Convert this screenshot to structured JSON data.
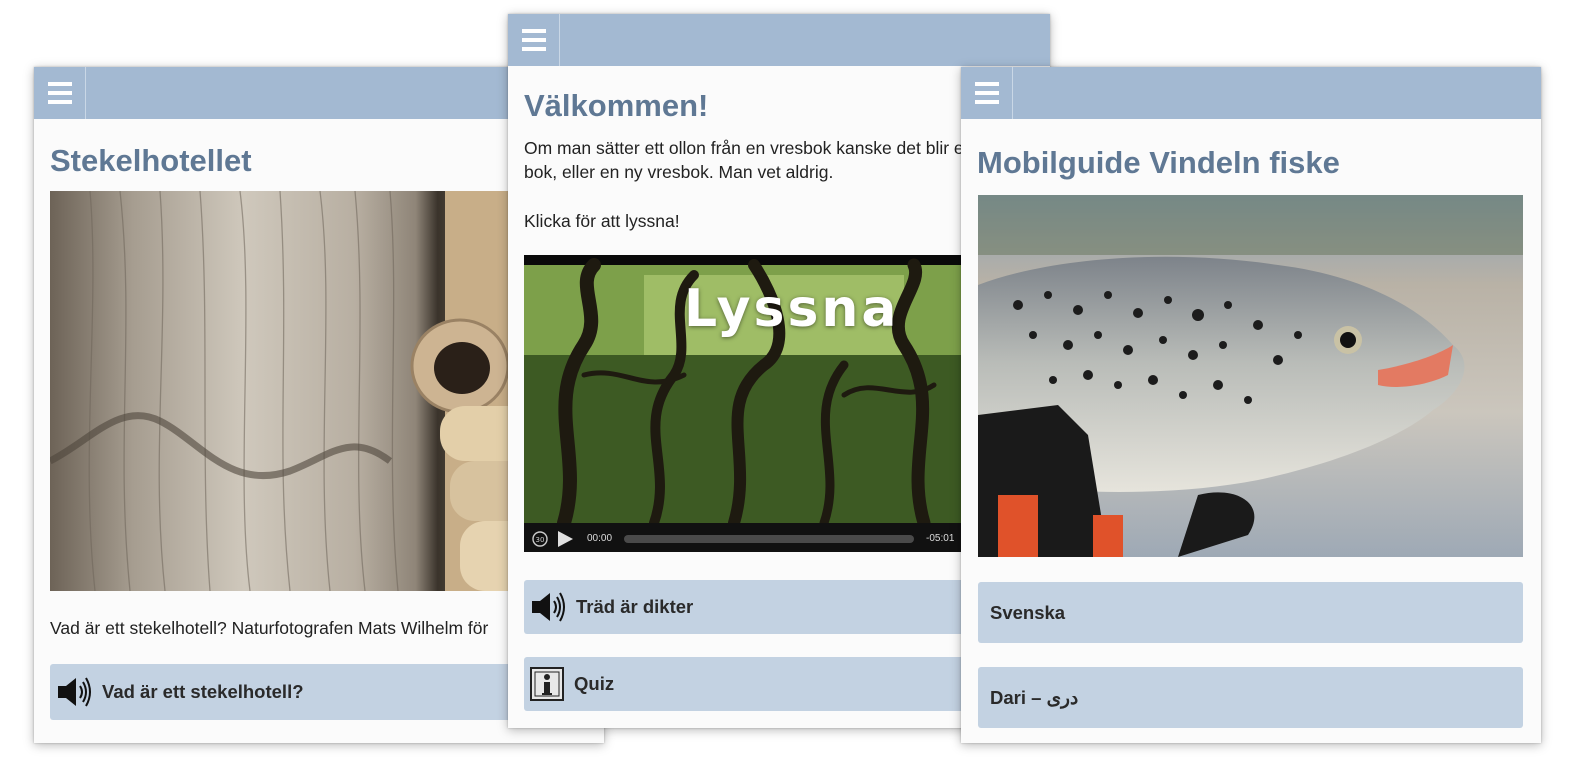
{
  "screens": [
    {
      "title": "Stekelhotellet",
      "body": "Vad är ett stekelhotell? Naturfotografen Mats Wilhelm för",
      "audio_button": "Vad är ett stekelhotell?"
    },
    {
      "title": "Välkommen!",
      "intro": "Om man sätter ett ollon från en vresbok kanske det blir en vanlig bok, eller en ny vresbok. Man vet aldrig.",
      "instruction": "Klicka för att lyssna!",
      "video": {
        "overlay_text": "Lyssna",
        "current_time": "00:00",
        "remaining_time": "-05:01",
        "progress": 0
      },
      "buttons": [
        {
          "label": "Träd är dikter",
          "icon": "speaker-icon"
        },
        {
          "label": "Quiz",
          "icon": "info-icon"
        }
      ]
    },
    {
      "title": "Mobilguide Vindeln fiske",
      "languages": [
        "Svenska",
        "Dari – دری"
      ]
    }
  ],
  "colors": {
    "header": "#a3b9d2",
    "button": "#c3d2e2",
    "title": "#5f7894"
  }
}
